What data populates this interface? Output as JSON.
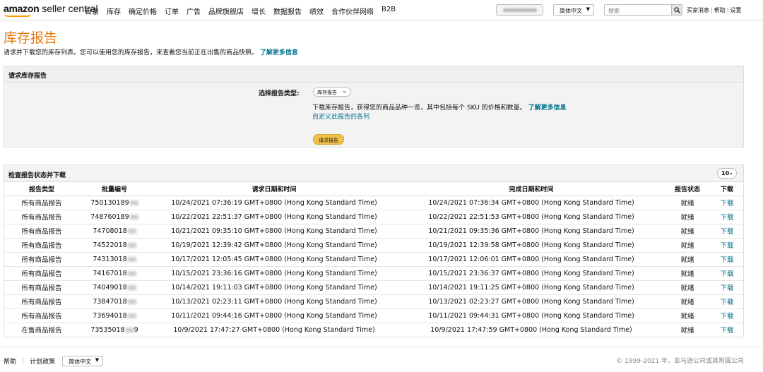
{
  "brand": {
    "amazon": "amazon",
    "seller": "seller central"
  },
  "nav": [
    "目录",
    "库存",
    "确定价格",
    "订单",
    "广告",
    "品牌旗舰店",
    "增长",
    "数据报告",
    "绩效",
    "合作伙伴网络",
    "B2B"
  ],
  "topbar": {
    "language": "简体中文",
    "search_placeholder": "搜索",
    "links": [
      "买家消息",
      "帮助",
      "设置"
    ]
  },
  "page": {
    "title": "库存报告",
    "intro": "请求并下载您的库存列表。您可以使用您的库存报告，来查看您当前正在出售的商品快照。",
    "learn_more": "了解更多信息"
  },
  "request_panel": {
    "heading": "请求库存报告",
    "type_label": "选择报告类型:",
    "type_value": "库存报告",
    "description": "下载库存报告，获得您的商品品种一览，其中包括每个 SKU 的价格和数量。",
    "learn_more": "了解更多信息",
    "customize": "自定义此报告的各列",
    "button": "请求报告"
  },
  "status_panel": {
    "heading": "检查报告状态并下载",
    "page_size": "10",
    "columns": [
      "报告类型",
      "批量编号",
      "请求日期和时间",
      "完成日期和时间",
      "报告状态",
      "下载"
    ],
    "rows": [
      {
        "type": "所有商品报告",
        "batch": "750130189",
        "requested": "10/24/2021 07:36:19 GMT+0800 (Hong Kong Standard Time)",
        "completed": "10/24/2021 07:36:34 GMT+0800 (Hong Kong Standard Time)",
        "status": "就绪",
        "download": "下载"
      },
      {
        "type": "所有商品报告",
        "batch": "748760189",
        "requested": "10/22/2021 22:51:37 GMT+0800 (Hong Kong Standard Time)",
        "completed": "10/22/2021 22:51:53 GMT+0800 (Hong Kong Standard Time)",
        "status": "就绪",
        "download": "下载"
      },
      {
        "type": "所有商品报告",
        "batch": "74708018",
        "requested": "10/21/2021 09:35:10 GMT+0800 (Hong Kong Standard Time)",
        "completed": "10/21/2021 09:35:36 GMT+0800 (Hong Kong Standard Time)",
        "status": "就绪",
        "download": "下载"
      },
      {
        "type": "所有商品报告",
        "batch": "74522018",
        "requested": "10/19/2021 12:39:42 GMT+0800 (Hong Kong Standard Time)",
        "completed": "10/19/2021 12:39:58 GMT+0800 (Hong Kong Standard Time)",
        "status": "就绪",
        "download": "下载"
      },
      {
        "type": "所有商品报告",
        "batch": "74313018",
        "requested": "10/17/2021 12:05:45 GMT+0800 (Hong Kong Standard Time)",
        "completed": "10/17/2021 12:06:01 GMT+0800 (Hong Kong Standard Time)",
        "status": "就绪",
        "download": "下载"
      },
      {
        "type": "所有商品报告",
        "batch": "74167018",
        "requested": "10/15/2021 23:36:16 GMT+0800 (Hong Kong Standard Time)",
        "completed": "10/15/2021 23:36:37 GMT+0800 (Hong Kong Standard Time)",
        "status": "就绪",
        "download": "下载"
      },
      {
        "type": "所有商品报告",
        "batch": "74049018",
        "requested": "10/14/2021 19:11:03 GMT+0800 (Hong Kong Standard Time)",
        "completed": "10/14/2021 19:11:25 GMT+0800 (Hong Kong Standard Time)",
        "status": "就绪",
        "download": "下载"
      },
      {
        "type": "所有商品报告",
        "batch": "73847018",
        "requested": "10/13/2021 02:23:11 GMT+0800 (Hong Kong Standard Time)",
        "completed": "10/13/2021 02:23:27 GMT+0800 (Hong Kong Standard Time)",
        "status": "就绪",
        "download": "下载"
      },
      {
        "type": "所有商品报告",
        "batch": "73694018",
        "requested": "10/11/2021 09:44:16 GMT+0800 (Hong Kong Standard Time)",
        "completed": "10/11/2021 09:44:31 GMT+0800 (Hong Kong Standard Time)",
        "status": "就绪",
        "download": "下载"
      },
      {
        "type": "在售商品报告",
        "batch": "73535018",
        "batch_suffix": "9",
        "requested": "10/9/2021 17:47:27 GMT+0800 (Hong Kong Standard Time)",
        "completed": "10/9/2021 17:47:59 GMT+0800 (Hong Kong Standard Time)",
        "status": "就绪",
        "download": "下载"
      }
    ]
  },
  "footer": {
    "links": [
      "帮助",
      "计划政策"
    ],
    "language": "简体中文",
    "copyright": "© 1999-2021 年，亚马逊公司或其附属公司"
  },
  "colors": {
    "title": "#e47911",
    "link": "#00738e",
    "button": "#f0c14b"
  }
}
